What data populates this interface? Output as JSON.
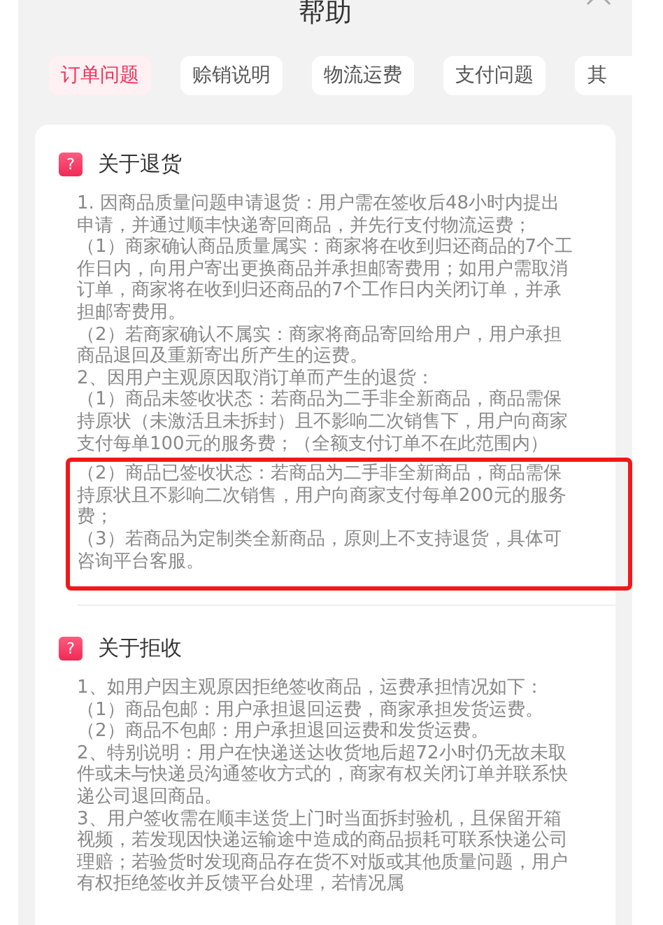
{
  "header": {
    "title": "帮助"
  },
  "tabs": [
    {
      "label": "订单问题",
      "selected": true
    },
    {
      "label": "赊销说明",
      "selected": false
    },
    {
      "label": "物流运费",
      "selected": false
    },
    {
      "label": "支付问题",
      "selected": false
    },
    {
      "label": "其",
      "selected": false
    }
  ],
  "sections": [
    {
      "icon": "?",
      "title": "关于退货",
      "paragraphs": [
        {
          "text": "1. 因商品质量问题申请退货：用户需在签收后48小时内提出申请，并通过顺丰快递寄回商品，并先行支付物流运费；",
          "highlighted": false
        },
        {
          "text": "（1）商家确认商品质量属实：商家将在收到归还商品的7个工作日内，向用户寄出更换商品并承担邮寄费用；如用户需取消订单，商家将在收到归还商品的7个工作日内关闭订单，并承担邮寄费用。",
          "highlighted": false
        },
        {
          "text": "（2）若商家确认不属实：商家将商品寄回给用户，用户承担商品退回及重新寄出所产生的运费。",
          "highlighted": false
        },
        {
          "text": "2、因用户主观原因取消订单而产生的退货：",
          "highlighted": false
        },
        {
          "text": "（1）商品未签收状态：若商品为二手非全新商品，商品需保持原状（未激活且未拆封）且不影响二次销售下，用户向商家支付每单100元的服务费；（全额支付订单不在此范围内）",
          "highlighted": false
        },
        {
          "text": "（2）商品已签收状态：若商品为二手非全新商品，商品需保持原状且不影响二次销售，用户向商家支付每单200元的服务费；",
          "highlighted": true
        },
        {
          "text": "（3）若商品为定制类全新商品，原则上不支持退货，具体可咨询平台客服。",
          "highlighted": true
        }
      ]
    },
    {
      "icon": "?",
      "title": "关于拒收",
      "paragraphs": [
        {
          "text": "1、如用户因主观原因拒绝签收商品，运费承担情况如下：",
          "highlighted": false
        },
        {
          "text": "（1）商品包邮：用户承担退回运费，商家承担发货运费。",
          "highlighted": false
        },
        {
          "text": "（2）商品不包邮：用户承担退回运费和发货运费。",
          "highlighted": false
        },
        {
          "text": "2、特别说明：用户在快递送达收货地后超72小时仍无故未取件或未与快递员沟通签收方式的，商家有权关闭订单并联系快递公司退回商品。",
          "highlighted": false
        },
        {
          "text": "3、用户签收需在顺丰送货上门时当面拆封验机，且保留开箱视频，若发现因快递运输途中造成的商品损耗可联系快递公司理赔；若验货时发现商品存在货不对版或其他质量问题，用户有权拒绝签收并反馈平台处理，若情况属",
          "highlighted": false
        }
      ]
    }
  ]
}
